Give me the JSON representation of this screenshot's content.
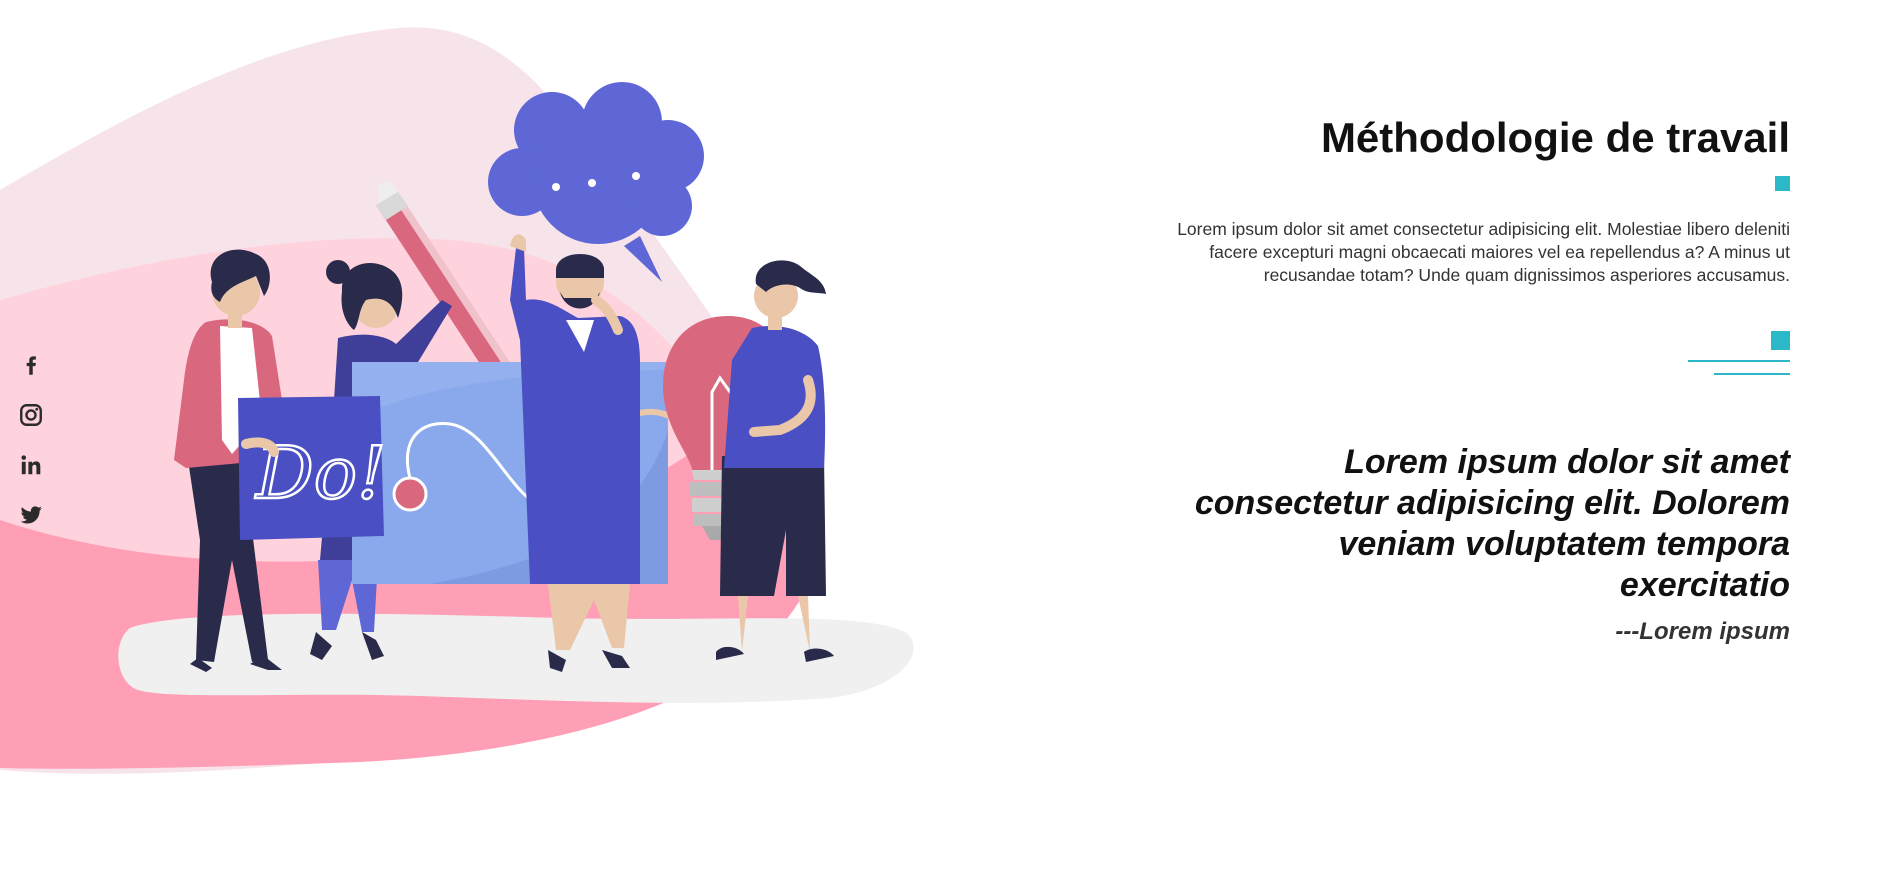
{
  "social": {
    "items": [
      {
        "icon": "facebook-icon"
      },
      {
        "icon": "instagram-icon"
      },
      {
        "icon": "linkedin-icon"
      },
      {
        "icon": "twitter-icon"
      }
    ]
  },
  "illustration": {
    "sign_text": "Do!",
    "colors": {
      "blob_light": "#f7e3ea",
      "blob_pink": "#ffd3de",
      "blob_deep": "#ff9fb6",
      "shadow": "#f0f0f0",
      "bubble": "#5f67d6",
      "board": "#8aa9ec",
      "sign": "#4a4fc3",
      "bulb": "#d9687f",
      "navy": "#2a2a4a",
      "skin": "#eac7a8"
    }
  },
  "section": {
    "title": "Méthodologie de travail",
    "description": "Lorem ipsum dolor sit amet consectetur adipisicing elit. Molestiae libero deleniti facere excepturi magni obcaecati maiores vel ea repellendus a? A minus ut recusandae totam? Unde quam dignissimos asperiores accusamus.",
    "quote": "Lorem ipsum dolor sit amet consectetur adipisicing elit. Dolorem veniam voluptatem tempora exercitatio",
    "author": "---Lorem ipsum"
  },
  "colors": {
    "accent": "#2bb8c8",
    "text": "#111111",
    "muted": "#333333"
  }
}
